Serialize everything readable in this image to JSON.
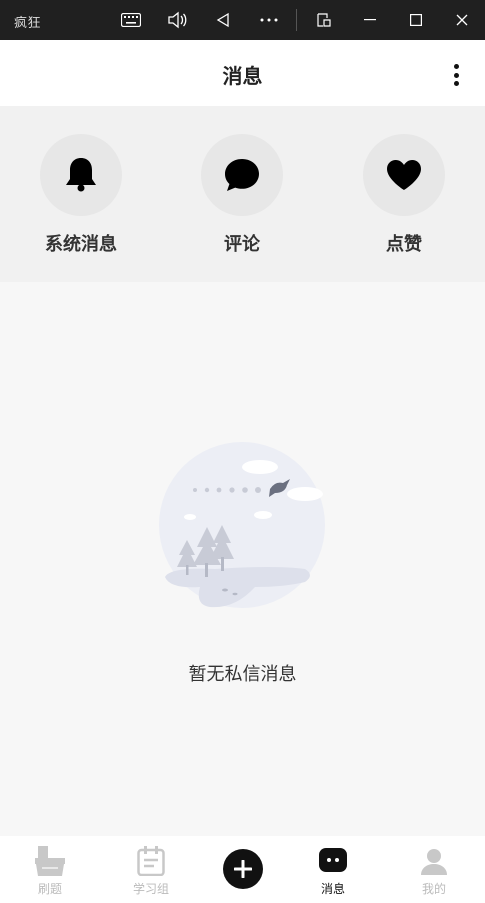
{
  "window": {
    "app_title": "疯狂",
    "controls": [
      "keyboard-icon",
      "volume-icon",
      "back-triangle-icon",
      "more-dots-icon",
      "popout-icon",
      "minimize-icon",
      "maximize-icon",
      "close-icon"
    ]
  },
  "header": {
    "title": "消息"
  },
  "quick_actions": [
    {
      "label": "系统消息",
      "icon": "bell-icon"
    },
    {
      "label": "评论",
      "icon": "comment-bubble-icon"
    },
    {
      "label": "点赞",
      "icon": "heart-icon"
    }
  ],
  "empty_state": {
    "message": "暂无私信消息"
  },
  "tabbar": {
    "items": [
      {
        "label": "刷题",
        "icon": "practice-icon",
        "active": false
      },
      {
        "label": "学习组",
        "icon": "study-group-icon",
        "active": false
      },
      {
        "label": "",
        "icon": "add-icon",
        "active": false
      },
      {
        "label": "消息",
        "icon": "message-icon",
        "active": true
      },
      {
        "label": "我的",
        "icon": "profile-icon",
        "active": false
      }
    ]
  },
  "colors": {
    "titlebar": "#202020",
    "accent": "#111111",
    "inactive_tab": "#bbbbbb",
    "quick_bg": "#f1f1f1",
    "circle_bg": "#e7e7e7"
  }
}
